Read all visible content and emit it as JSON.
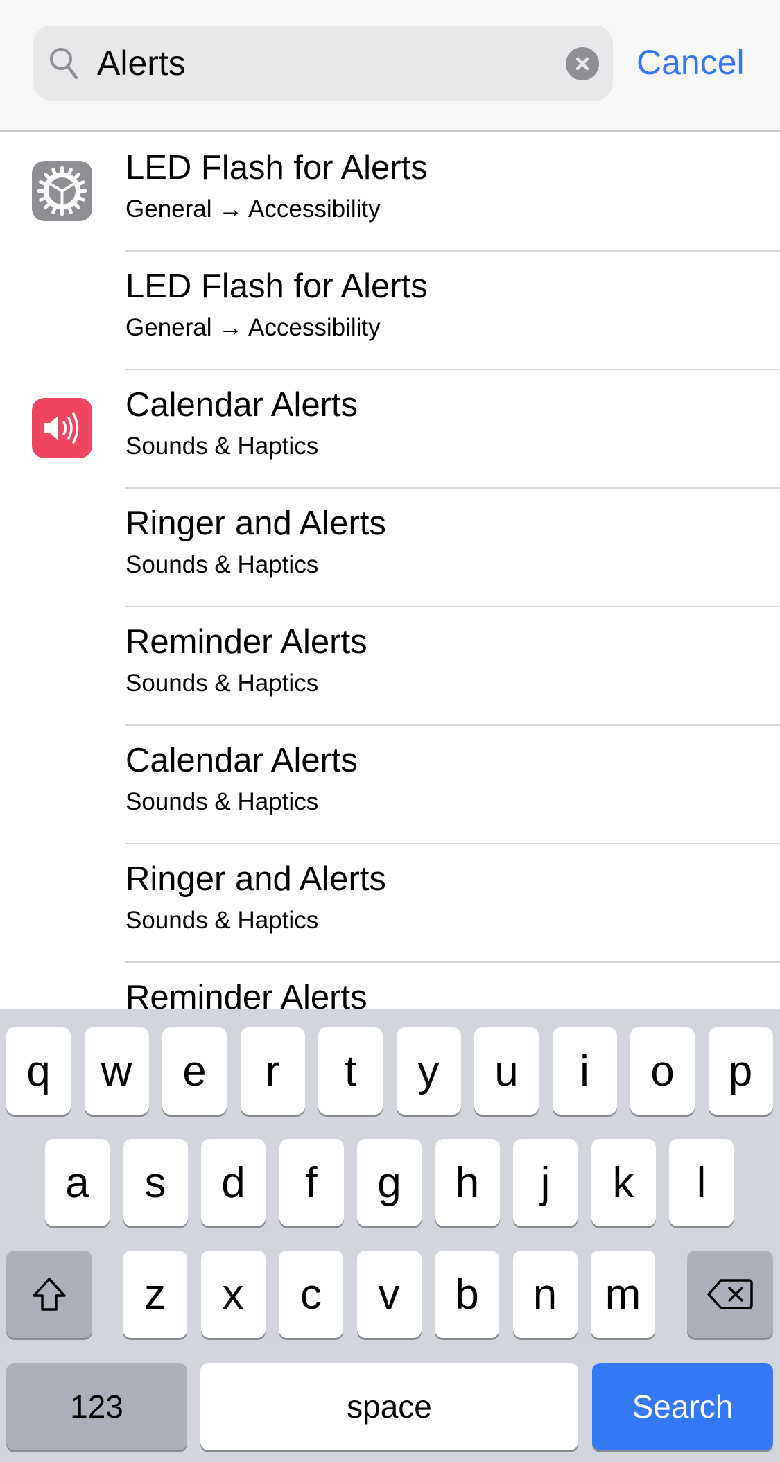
{
  "search": {
    "query": "Alerts",
    "cancel_label": "Cancel"
  },
  "results": [
    {
      "title": "LED Flash for Alerts",
      "subtitle": "General → Accessibility",
      "icon": "gear-icon",
      "icon_color": "#8e8e93"
    },
    {
      "title": "LED Flash for Alerts",
      "subtitle": "General → Accessibility",
      "icon": null
    },
    {
      "title": "Calendar Alerts",
      "subtitle": "Sounds & Haptics",
      "icon": "speaker-icon",
      "icon_color": "#ee4560"
    },
    {
      "title": "Ringer and Alerts",
      "subtitle": "Sounds & Haptics",
      "icon": null
    },
    {
      "title": "Reminder Alerts",
      "subtitle": "Sounds & Haptics",
      "icon": null
    },
    {
      "title": "Calendar Alerts",
      "subtitle": "Sounds & Haptics",
      "icon": null
    },
    {
      "title": "Ringer and Alerts",
      "subtitle": "Sounds & Haptics",
      "icon": null
    },
    {
      "title": "Reminder Alerts",
      "subtitle": "",
      "icon": null
    }
  ],
  "keyboard": {
    "row1": [
      "q",
      "w",
      "e",
      "r",
      "t",
      "y",
      "u",
      "i",
      "o",
      "p"
    ],
    "row2": [
      "a",
      "s",
      "d",
      "f",
      "g",
      "h",
      "j",
      "k",
      "l"
    ],
    "row3": [
      "z",
      "x",
      "c",
      "v",
      "b",
      "n",
      "m"
    ],
    "numbers_label": "123",
    "space_label": "space",
    "search_label": "Search",
    "shift_icon": "shift-icon",
    "delete_icon": "delete-icon"
  },
  "colors": {
    "accent": "#3478f6",
    "settings_gray": "#8e8e93",
    "sounds_red": "#ee4560"
  }
}
